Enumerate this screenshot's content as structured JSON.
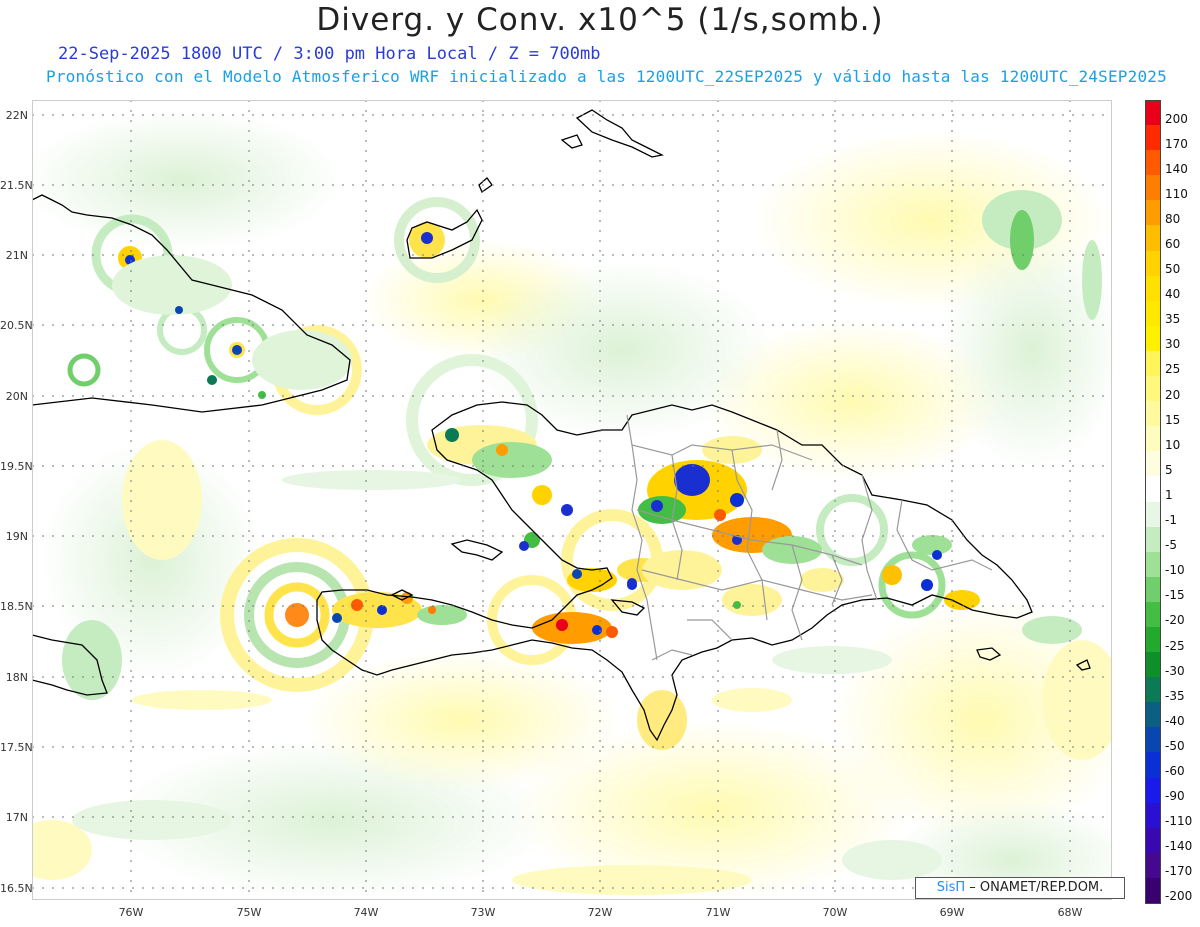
{
  "header": {
    "title": "Diverg. y Conv. x10^5 (1/s,somb.)",
    "subtitle_time": "22-Sep-2025  1800 UTC / 3:00 pm Hora Local / Z = 700mb",
    "subtitle_model": "Pronóstico con el Modelo Atmosferico WRF inicializado a las 1200UTC_22SEP2025 y válido hasta las  1200UTC_24SEP2025"
  },
  "axes": {
    "lat_labels": [
      "22N",
      "21.5N",
      "21N",
      "20.5N",
      "20N",
      "19.5N",
      "19N",
      "18.5N",
      "18N",
      "17.5N",
      "17N",
      "16.5N"
    ],
    "lon_labels": [
      "76W",
      "75W",
      "74W",
      "73W",
      "72W",
      "71W",
      "70W",
      "69W",
      "68W"
    ]
  },
  "colorbar": {
    "labels": [
      "200",
      "170",
      "140",
      "110",
      "80",
      "60",
      "50",
      "40",
      "35",
      "30",
      "25",
      "20",
      "15",
      "10",
      "5",
      "1",
      "-1",
      "-5",
      "-10",
      "-15",
      "-20",
      "-25",
      "-30",
      "-35",
      "-40",
      "-50",
      "-60",
      "-90",
      "-110",
      "-140",
      "-170",
      "-200"
    ],
    "colors": [
      "#e8001a",
      "#ff2a00",
      "#ff5a00",
      "#ff7d00",
      "#ff9d00",
      "#ffbd00",
      "#ffd200",
      "#ffe000",
      "#ffe800",
      "#fff000",
      "#fff45a",
      "#fff87d",
      "#fffaa0",
      "#fffcc0",
      "#fffde0",
      "#ffffff",
      "#e8f6e6",
      "#c4ecc0",
      "#9ee096",
      "#70cf6a",
      "#44bd44",
      "#22a92e",
      "#0f8f2a",
      "#0c7a55",
      "#0a5f82",
      "#0a46b0",
      "#0a2fd5",
      "#1a1aea",
      "#2a10d0",
      "#3a08b0",
      "#46088e",
      "#3a0070"
    ]
  },
  "credit": {
    "brand": "SisΠ",
    "text": " – ONAMET/REP.DOM."
  }
}
